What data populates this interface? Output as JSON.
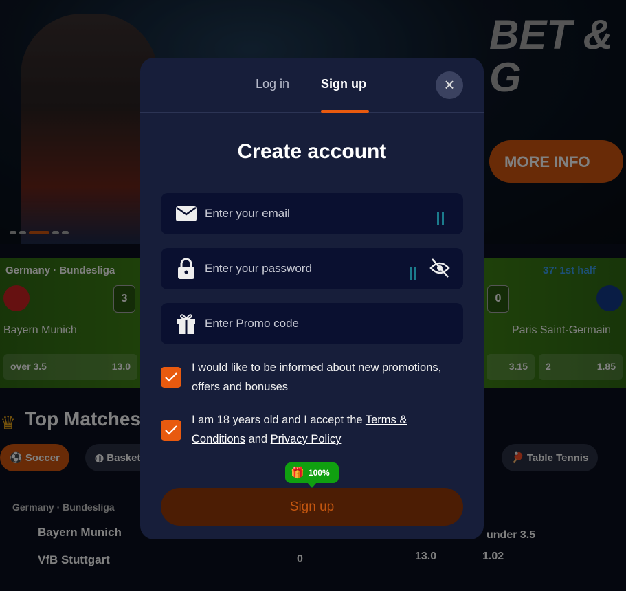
{
  "background": {
    "hero_title": "BET & G",
    "more_info": "MORE INFO",
    "live": {
      "league": "Germany · Bundesliga",
      "home": "Bayern Munich",
      "home_score": "3",
      "odd1_label": "over 3.5",
      "odd1_value": "13.0",
      "time": "37' 1st half",
      "away_score": "0",
      "away": "Paris Saint-Germain",
      "odd2_value": "3.15",
      "odd3_label": "2",
      "odd3_value": "1.85"
    },
    "top_matches": "Top Matches",
    "sports": [
      "Soccer",
      "Basketball",
      "Table Tennis"
    ],
    "match": {
      "league": "Germany · Bundesliga",
      "home": "Bayern Munich",
      "away": "VfB Stuttgart",
      "away_score": "0",
      "odd_label": "under 3.5",
      "odd1": "13.0",
      "odd2": "1.02"
    }
  },
  "modal": {
    "tabs": [
      {
        "label": "Log in",
        "active": false
      },
      {
        "label": "Sign up",
        "active": true
      }
    ],
    "title": "Create account",
    "email_placeholder": "Enter your email",
    "password_placeholder": "Enter your password",
    "promo_placeholder": "Enter Promo code",
    "consent1": "I would like to be informed about new promotions, offers and bonuses",
    "consent2_prefix": "I am 18 years old and I accept the ",
    "terms_link": "Terms & Conditions",
    "consent2_mid": " and ",
    "privacy_link": "Privacy Policy",
    "badge": "100%",
    "submit": "Sign up"
  },
  "colors": {
    "accent": "#e85a0f",
    "modal_bg": "#171e3a",
    "input_bg": "#0a1030",
    "badge": "#10a010"
  }
}
